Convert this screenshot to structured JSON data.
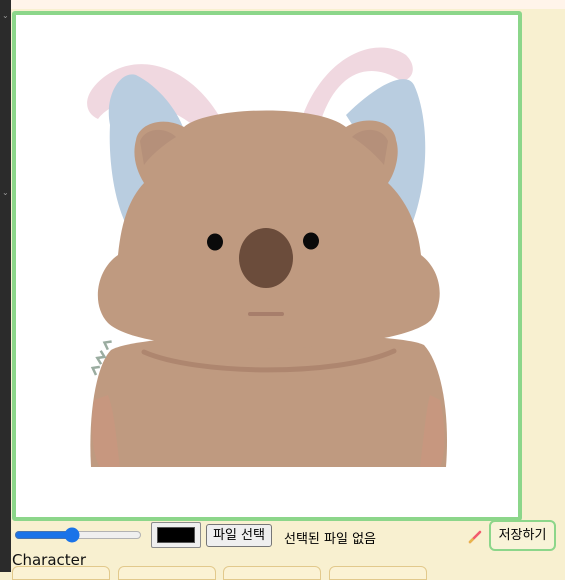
{
  "toolbar": {
    "brush_size": 45,
    "color_value": "#000000",
    "file_button_label": "파일 선택",
    "file_status": "선택된 파일 없음",
    "save_label": "저장하기"
  },
  "section": {
    "label": "Character"
  },
  "character_tabs": [
    "",
    "",
    "",
    ""
  ],
  "colors": {
    "accent_border": "#8cd68a",
    "page_background": "#f8f0d0",
    "slider_accent": "#1a73e8"
  },
  "icons": [
    "chevron-down-icon",
    "pencil-icon"
  ]
}
